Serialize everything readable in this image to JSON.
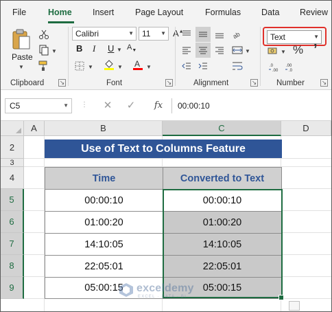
{
  "tabs": [
    "File",
    "Home",
    "Insert",
    "Page Layout",
    "Formulas",
    "Data",
    "Review"
  ],
  "active_tab": "Home",
  "ribbon": {
    "clipboard": {
      "paste_label": "Paste",
      "group_label": "Clipboard"
    },
    "font": {
      "family": "Calibri",
      "size": "11",
      "group_label": "Font",
      "fill_color": "#ffff00",
      "font_color": "#ff0000"
    },
    "alignment": {
      "group_label": "Alignment"
    },
    "number": {
      "format": "Text",
      "group_label": "Number"
    }
  },
  "formula_bar": {
    "name_box": "C5",
    "fx_label": "fx",
    "value": "00:00:10"
  },
  "sheet": {
    "columns": [
      "A",
      "B",
      "C",
      "D"
    ],
    "rows": [
      "2",
      "3",
      "4",
      "5",
      "6",
      "7",
      "8",
      "9"
    ],
    "title": "Use of Text to Columns Feature",
    "headers": [
      "Time",
      "Converted to Text"
    ],
    "data": [
      [
        "00:00:10",
        "00:00:10"
      ],
      [
        "01:00:20",
        "01:00:20"
      ],
      [
        "14:10:05",
        "14:10:05"
      ],
      [
        "22:05:01",
        "22:05:01"
      ],
      [
        "05:00:15",
        "05:00:15"
      ]
    ]
  },
  "watermark": {
    "name": "exceldemy",
    "tagline": "EXCEL · DATA · BI"
  },
  "colors": {
    "accent_green": "#1e6c41",
    "title_blue": "#2f5597",
    "highlight_red": "#e0302a"
  }
}
